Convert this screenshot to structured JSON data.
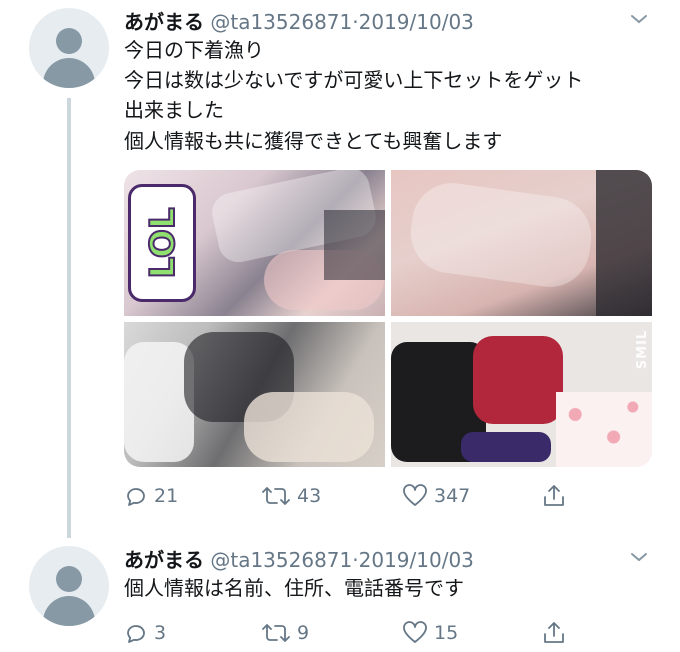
{
  "tweets": [
    {
      "display_name": "あがまる",
      "handle": "@ta13526871",
      "separator": "·",
      "date": "2019/10/03",
      "lines": [
        "今日の下着漁り",
        "今日は数は少ないですが可愛い上下セットをゲット",
        "出来ました",
        "個人情報も共に獲得できとても興奮します"
      ],
      "media": {
        "sticker_text": "LOL",
        "watermark": "SMIL",
        "images": [
          "pink-lace-bra-in-bag",
          "pink-lingerie-in-bag",
          "clear-bags-pile",
          "black-red-floral-bras"
        ]
      },
      "actions": {
        "reply_count": "21",
        "retweet_count": "43",
        "like_count": "347"
      }
    },
    {
      "display_name": "あがまる",
      "handle": "@ta13526871",
      "separator": "·",
      "date": "2019/10/03",
      "lines": [
        "個人情報は名前、住所、電話番号です"
      ],
      "actions": {
        "reply_count": "3",
        "retweet_count": "9",
        "like_count": "15"
      }
    }
  ],
  "colors": {
    "text": "#14171a",
    "secondary": "#657786",
    "thread_line": "#ccd6dd"
  },
  "icons": [
    "reply-icon",
    "retweet-icon",
    "like-icon",
    "share-icon",
    "chevron-down-icon",
    "avatar-placeholder-icon"
  ]
}
